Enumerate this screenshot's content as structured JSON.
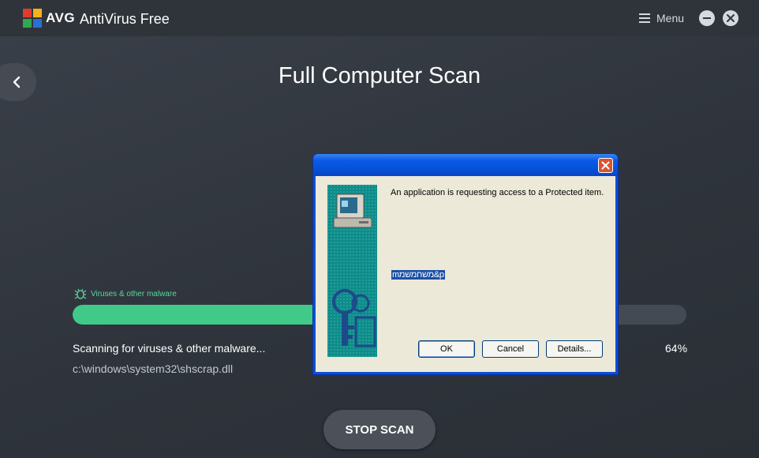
{
  "app": {
    "brand": "AVG",
    "product": "AntiVirus Free",
    "menu_label": "Menu",
    "logo_icon": "avg-logo-icon"
  },
  "scan": {
    "title": "Full Computer Scan",
    "category_label": "Viruses & other malware",
    "status_text": "Scanning for viruses & other malware...",
    "current_file": "c:\\windows\\system32\\shscrap.dll",
    "percent_label": "64%",
    "progress_fraction": 0.64,
    "stop_button": "STOP SCAN"
  },
  "dialog": {
    "message": "An application is requesting access to a Protected item.",
    "item_text": "mמשחמשמ&p",
    "buttons": {
      "ok": "OK",
      "cancel": "Cancel",
      "details": "Details..."
    }
  },
  "colors": {
    "accent_green": "#41c98a",
    "background": "#30353c",
    "xp_blue": "#0a4fd8",
    "dialog_face": "#ece9d8"
  }
}
